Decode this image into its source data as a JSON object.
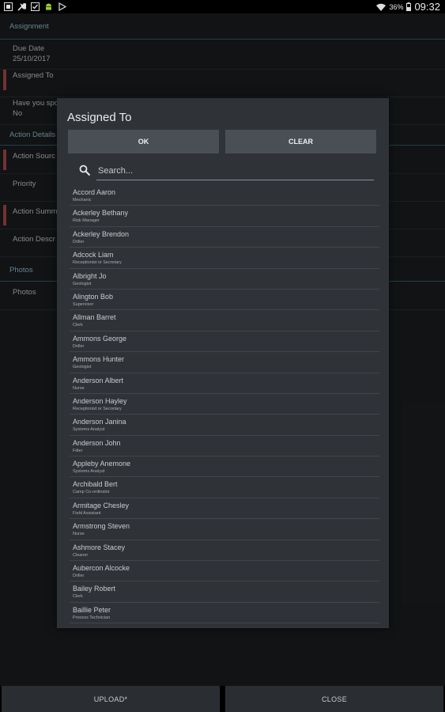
{
  "status_bar": {
    "battery_percent": "36%",
    "time": "09:32",
    "left_icons": [
      "notification-icon",
      "wrench-icon",
      "checkbox-icon",
      "android-icon",
      "play-icon"
    ],
    "right_icons": [
      "wifi-icon",
      "battery-icon"
    ]
  },
  "form": {
    "assignment_section": "Assignment",
    "due_date_label": "Due Date",
    "due_date_value": "25/10/2017",
    "assigned_to_label": "Assigned To",
    "have_you_label": "Have you spo",
    "have_you_value": "No",
    "action_details_section": "Action Details",
    "action_source_label": "Action Sourc",
    "priority_label": "Priority",
    "action_summary_label": "Action Summ",
    "action_description_label": "Action Descr",
    "photos_section": "Photos",
    "photos_label": "Photos"
  },
  "bottom_bar": {
    "upload_label": "UPLOAD*",
    "close_label": "CLOSE"
  },
  "dialog": {
    "title": "Assigned To",
    "ok_label": "OK",
    "clear_label": "CLEAR",
    "search_placeholder": "Search...",
    "items": [
      {
        "name": "Accord Aaron",
        "role": "Mechanic"
      },
      {
        "name": "Ackerley Bethany",
        "role": "Risk Manager"
      },
      {
        "name": "Ackerley Brendon",
        "role": "Driller"
      },
      {
        "name": "Adcock Liam",
        "role": "Receptionist or Secretary"
      },
      {
        "name": "Albright Jo",
        "role": "Geologist"
      },
      {
        "name": "Alington Bob",
        "role": "Supervisor"
      },
      {
        "name": "Allman Barret",
        "role": "Clerk"
      },
      {
        "name": "Ammons George",
        "role": "Driller"
      },
      {
        "name": "Ammons Hunter",
        "role": "Geologist"
      },
      {
        "name": "Anderson Albert",
        "role": "Nurse"
      },
      {
        "name": "Anderson Hayley",
        "role": "Receptionist or Secretary"
      },
      {
        "name": "Anderson Janina",
        "role": "Systems Analyst"
      },
      {
        "name": "Anderson John",
        "role": "Fitter"
      },
      {
        "name": "Appleby Anemone",
        "role": "Systems Analyst"
      },
      {
        "name": "Archibald Bert",
        "role": "Camp Co-ordinator"
      },
      {
        "name": "Armitage Chesley",
        "role": "Field Assistant"
      },
      {
        "name": "Armstrong Steven",
        "role": "Nurse"
      },
      {
        "name": "Ashmore Stacey",
        "role": "Cleaner"
      },
      {
        "name": "Aubercon Alcocke",
        "role": "Driller"
      },
      {
        "name": "Bailey Robert",
        "role": "Clerk"
      },
      {
        "name": "Baillie Peter",
        "role": "Process Technician"
      }
    ]
  },
  "colors": {
    "required_marker": "#b24a4a",
    "section_accent": "#3d8590",
    "dialog_bg": "#2f3338",
    "button_bg": "#4a4f55"
  }
}
